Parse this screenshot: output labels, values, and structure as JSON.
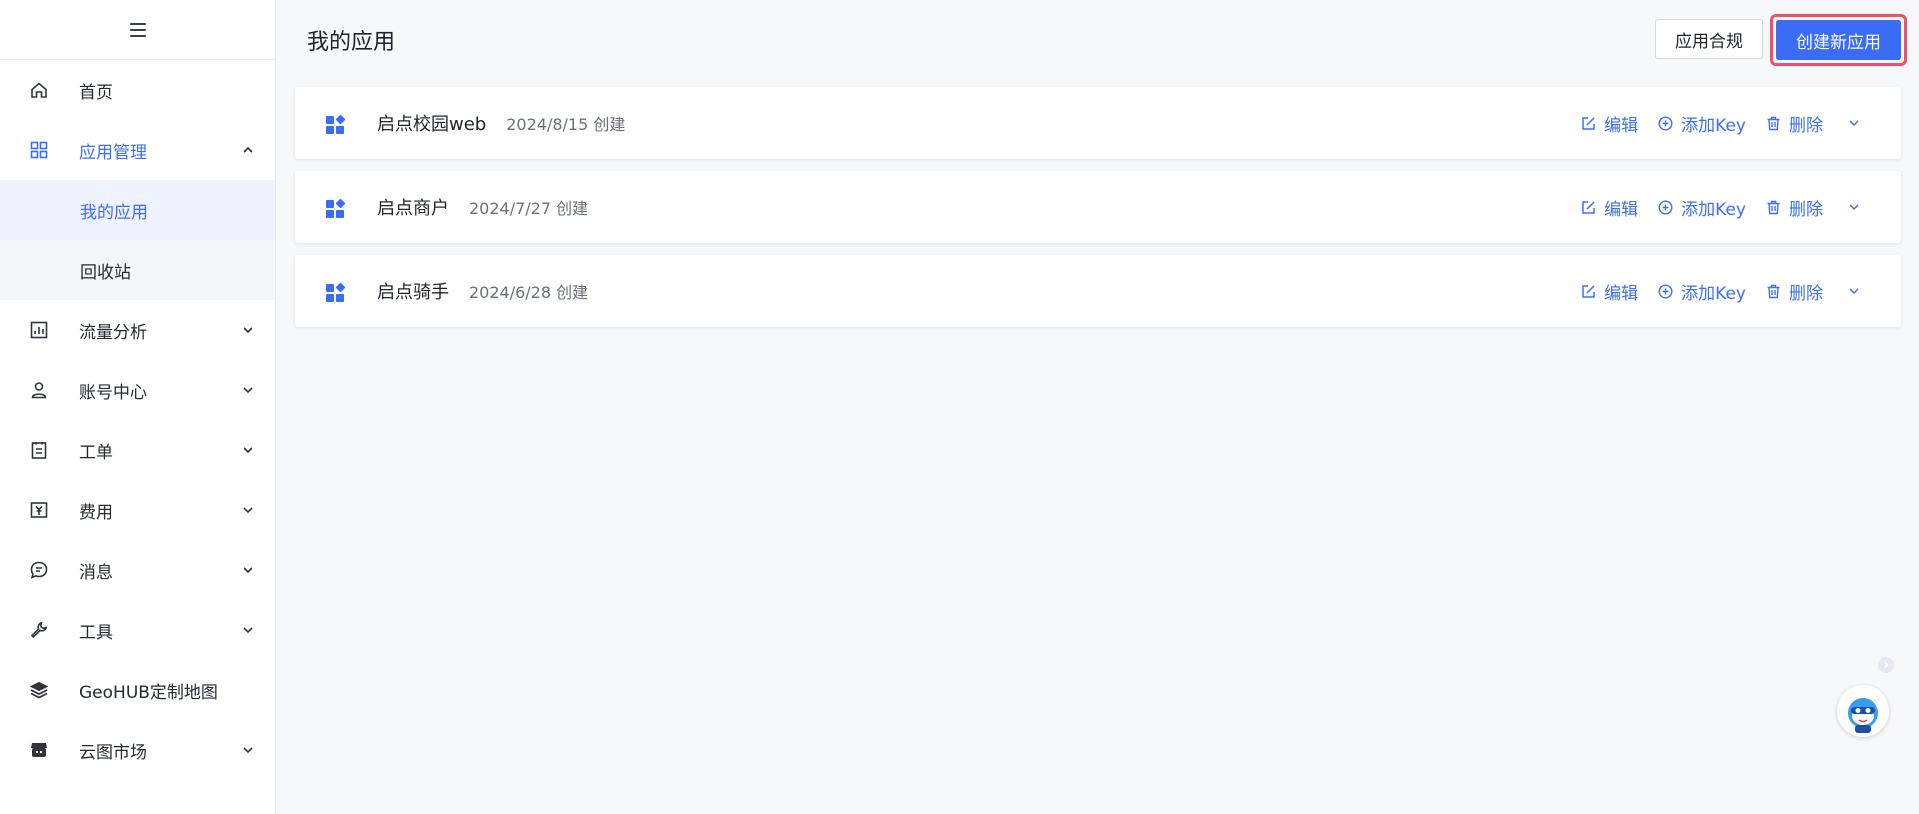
{
  "sidebar": {
    "items": [
      {
        "label": "首页",
        "icon": "home-icon"
      },
      {
        "label": "应用管理",
        "icon": "grid-icon",
        "expanded": true,
        "children": [
          {
            "label": "我的应用",
            "selected": true
          },
          {
            "label": "回收站"
          }
        ]
      },
      {
        "label": "流量分析",
        "icon": "chart-icon"
      },
      {
        "label": "账号中心",
        "icon": "user-icon"
      },
      {
        "label": "工单",
        "icon": "clipboard-icon"
      },
      {
        "label": "费用",
        "icon": "currency-icon"
      },
      {
        "label": "消息",
        "icon": "message-icon"
      },
      {
        "label": "工具",
        "icon": "wrench-icon"
      },
      {
        "label": "GeoHUB定制地图",
        "icon": "layers-icon"
      },
      {
        "label": "云图市场",
        "icon": "store-icon"
      }
    ]
  },
  "header": {
    "title": "我的应用",
    "compliance_label": "应用合规",
    "create_label": "创建新应用"
  },
  "apps": [
    {
      "name": "启点校园web",
      "date": "2024/8/15 创建"
    },
    {
      "name": "启点商户",
      "date": "2024/7/27 创建"
    },
    {
      "name": "启点骑手",
      "date": "2024/6/28 创建"
    }
  ],
  "actions": {
    "edit": "编辑",
    "add_key": "添加Key",
    "delete": "删除"
  },
  "colors": {
    "accent": "#3d6ef5",
    "highlight_border": "#f0506e"
  }
}
